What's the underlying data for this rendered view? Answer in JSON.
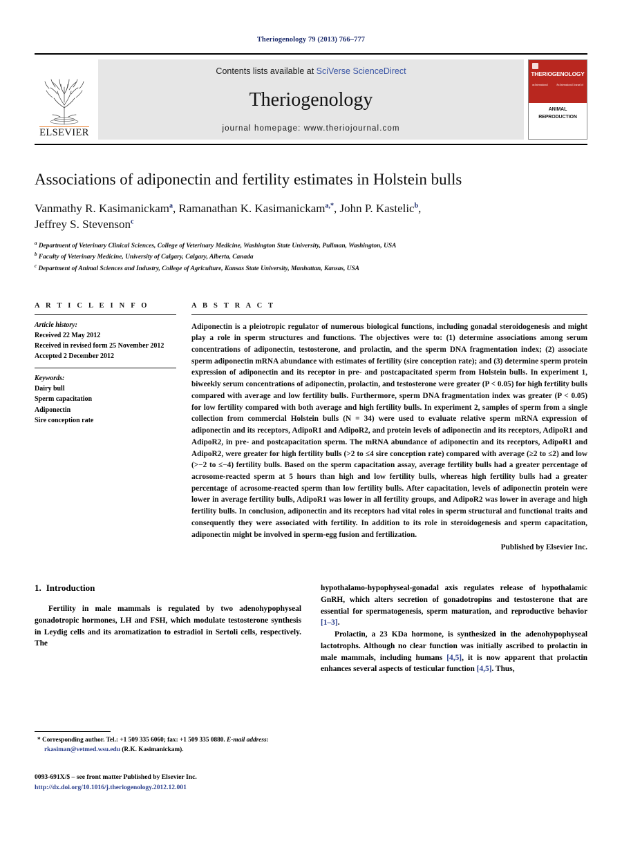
{
  "running_head": "Theriogenology 79 (2013) 766–777",
  "masthead": {
    "publisher_name": "ELSEVIER",
    "contents_prefix": "Contents lists available at ",
    "contents_link": "SciVerse ScienceDirect",
    "journal_name": "Theriogenology",
    "homepage_label": "journal homepage: www.theriojournal.com",
    "cover": {
      "title": "THERIOGENOLOGY",
      "left_tag": "an International",
      "right_tag": "An International Journal of",
      "line1": "ANIMAL",
      "line2": "REPRODUCTION"
    }
  },
  "article": {
    "title": "Associations of adiponectin and fertility estimates in Holstein bulls",
    "authors_line1": "Vanmathy R. Kasimanickam",
    "authors_line1_sup": "a",
    "authors_line2": "Ramanathan K. Kasimanickam",
    "authors_line2_sup": "a,*",
    "authors_line3": "John P. Kastelic",
    "authors_line3_sup": "b",
    "authors_line4": "Jeffrey S. Stevenson",
    "authors_line4_sup": "c",
    "affiliations": [
      {
        "sup": "a",
        "text": "Department of Veterinary Clinical Sciences, College of Veterinary Medicine, Washington State University, Pullman, Washington, USA"
      },
      {
        "sup": "b",
        "text": "Faculty of Veterinary Medicine, University of Calgary, Calgary, Alberta, Canada"
      },
      {
        "sup": "c",
        "text": "Department of Animal Sciences and Industry, College of Agriculture, Kansas State University, Manhattan, Kansas, USA"
      }
    ]
  },
  "article_info": {
    "heading": "A R T I C L E   I N F O",
    "history_label": "Article history:",
    "history": [
      "Received 22 May 2012",
      "Received in revised form 25 November 2012",
      "Accepted 2 December 2012"
    ],
    "keywords_label": "Keywords:",
    "keywords": [
      "Dairy bull",
      "Sperm capacitation",
      "Adiponectin",
      "Sire conception rate"
    ]
  },
  "abstract": {
    "heading": "A B S T R A C T",
    "text": "Adiponectin is a pleiotropic regulator of numerous biological functions, including gonadal steroidogenesis and might play a role in sperm structures and functions. The objectives were to: (1) determine associations among serum concentrations of adiponectin, testosterone, and prolactin, and the sperm DNA fragmentation index; (2) associate sperm adiponectin mRNA abundance with estimates of fertility (sire conception rate); and (3) determine sperm protein expression of adiponectin and its receptor in pre- and postcapacitated sperm from Holstein bulls. In experiment 1, biweekly serum concentrations of adiponectin, prolactin, and testosterone were greater (P < 0.05) for high fertility bulls compared with average and low fertility bulls. Furthermore, sperm DNA fragmentation index was greater (P < 0.05) for low fertility compared with both average and high fertility bulls. In experiment 2, samples of sperm from a single collection from commercial Holstein bulls (N = 34) were used to evaluate relative sperm mRNA expression of adiponectin and its receptors, AdipoR1 and AdipoR2, and protein levels of adiponectin and its receptors, AdipoR1 and AdipoR2, in pre- and postcapacitation sperm. The mRNA abundance of adiponectin and its receptors, AdipoR1 and AdipoR2, were greater for high fertility bulls (>2 to ≤4 sire conception rate) compared with average (≥2 to ≤2) and low (>−2 to ≤−4) fertility bulls. Based on the sperm capacitation assay, average fertility bulls had a greater percentage of acrosome-reacted sperm at 5 hours than high and low fertility bulls, whereas high fertility bulls had a greater percentage of acrosome-reacted sperm than low fertility bulls. After capacitation, levels of adiponectin protein were lower in average fertility bulls, AdipoR1 was lower in all fertility groups, and AdipoR2 was lower in average and high fertility bulls. In conclusion, adiponectin and its receptors had vital roles in sperm structural and functional traits and consequently they were associated with fertility. In addition to its role in steroidogenesis and sperm capacitation, adiponectin might be involved in sperm-egg fusion and fertilization.",
    "publisher_statement": "Published by Elsevier Inc."
  },
  "introduction": {
    "number": "1.",
    "heading": "Introduction",
    "para1": "Fertility in male mammals is regulated by two adenohypophyseal gonadotropic hormones, LH and FSH, which modulate testosterone synthesis in Leydig cells and its aromatization to estradiol in Sertoli cells, respectively. The",
    "para1_cont": "hypothalamo-hypophyseal-gonadal axis regulates release of hypothalamic GnRH, which alters secretion of gonadotropins and testosterone that are essential for spermatogenesis, sperm maturation, and reproductive behavior ",
    "para1_ref": "[1–3]",
    "para1_end": ".",
    "para2_a": "Prolactin, a 23 KDa hormone, is synthesized in the adenohypophyseal lactotrophs. Although no clear function was initially ascribed to prolactin in male mammals, including humans ",
    "para2_ref1": "[4,5]",
    "para2_b": ", it is now apparent that prolactin enhances several aspects of testicular function ",
    "para2_ref2": "[4,5]",
    "para2_c": ". Thus,"
  },
  "footnotes": {
    "corresponding_marker": "*",
    "corresponding_text": "Corresponding author. Tel.: +1 509 335 6060; fax: +1 509 335 0880.",
    "email_label": "E-mail address:",
    "email": "rkasiman@vetmed.wsu.edu",
    "email_owner": "(R.K. Kasimanickam).",
    "issn_line": "0093-691X/$ – see front matter Published by Elsevier Inc.",
    "doi": "http://dx.doi.org/10.1016/j.theriogenology.2012.12.001"
  },
  "colors": {
    "running_head": "#1b2a6b",
    "link": "#2b3f8c",
    "sciencedirect": "#3a55a5",
    "elsevier_orange": "#e87722",
    "cover_red": "#b9271f",
    "band_gray": "#e6e6e6"
  }
}
